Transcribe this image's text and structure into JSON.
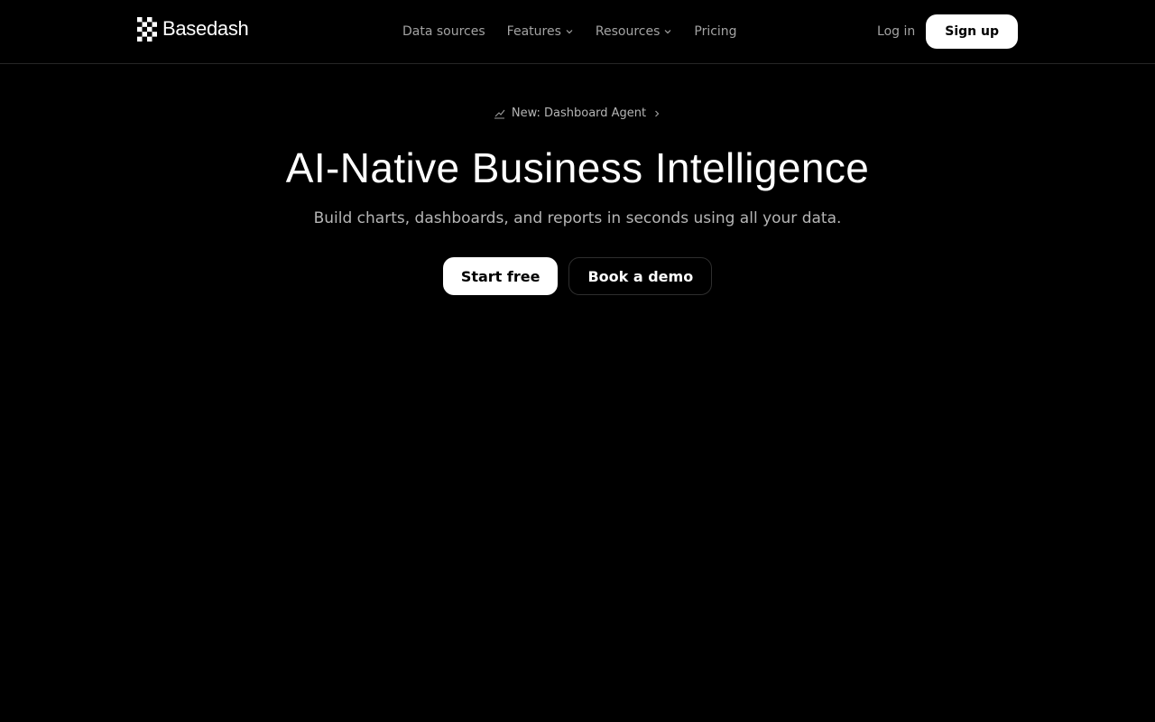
{
  "brand": {
    "name": "Basedash",
    "logo_icon": "checkerboard-logo-icon"
  },
  "nav": {
    "items": [
      {
        "label": "Data sources",
        "has_dropdown": false
      },
      {
        "label": "Features",
        "has_dropdown": true
      },
      {
        "label": "Resources",
        "has_dropdown": true
      },
      {
        "label": "Pricing",
        "has_dropdown": false
      }
    ],
    "login_label": "Log in",
    "signup_label": "Sign up"
  },
  "announcement": {
    "icon": "chart-line-icon",
    "text": "New: Dashboard Agent",
    "arrow_icon": "chevron-right-icon"
  },
  "hero": {
    "title": "AI-Native Business Intelligence",
    "subtitle": "Build charts, dashboards, and reports in seconds using all your data.",
    "primary_cta": "Start free",
    "secondary_cta": "Book a demo"
  },
  "colors": {
    "background": "#000000",
    "text": "#ffffff",
    "muted_text": "#a3a3a3",
    "button_primary_bg": "#ffffff",
    "button_primary_text": "#000000",
    "divider": "#262626"
  }
}
